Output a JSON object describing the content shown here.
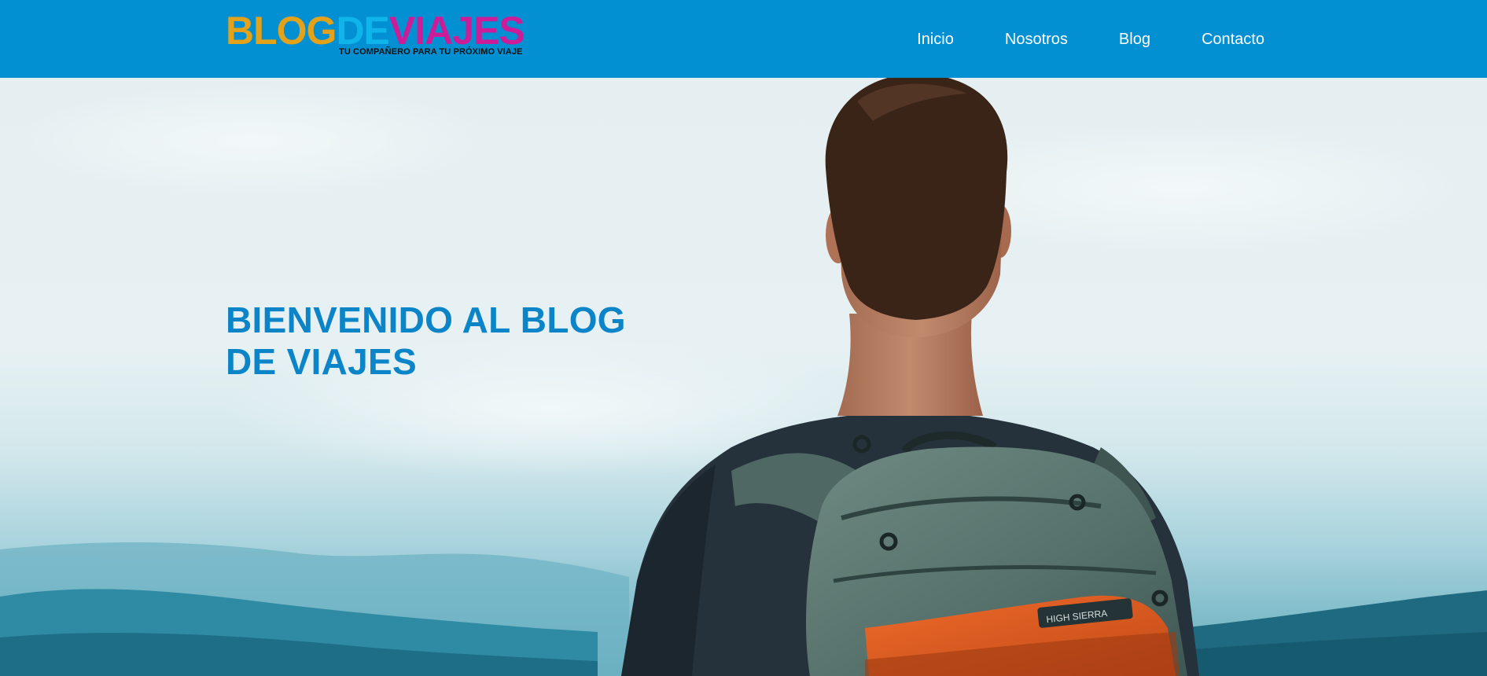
{
  "header": {
    "logo": {
      "parts": [
        {
          "text": "BLOG",
          "color": "#e3a21a"
        },
        {
          "text": "DE",
          "color": "#0fb4ea"
        },
        {
          "text": "VIAJES",
          "color": "#cc1c97"
        }
      ],
      "tagline": "TU COMPAÑERO PARA TU PRÓXIMO VIAJE"
    },
    "nav": {
      "items": [
        {
          "label": "Inicio"
        },
        {
          "label": "Nosotros"
        },
        {
          "label": "Blog"
        },
        {
          "label": "Contacto"
        }
      ]
    }
  },
  "hero": {
    "title": "BIENVENIDO AL BLOG DE VIAJES",
    "image": "hiker-with-backpack-photo",
    "backpack_text": "HIGH SIERRA"
  },
  "colors": {
    "header_bg": "#0290d3",
    "hero_title": "#0b84c8",
    "nav_text": "#ffffff"
  }
}
